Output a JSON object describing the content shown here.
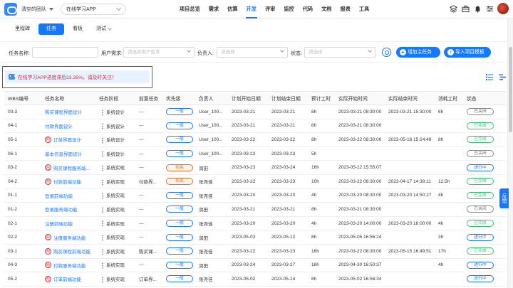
{
  "header": {
    "team_name": "清空的团队",
    "project": "在线学习APP",
    "nav": [
      "项目总览",
      "需求",
      "估算",
      "开发",
      "评审",
      "监控",
      "代码",
      "文档",
      "报表",
      "工具"
    ],
    "active_nav": "开发"
  },
  "subtabs": {
    "items": [
      "里程碑",
      "任务",
      "看板",
      "测试"
    ],
    "active": "任务"
  },
  "filters": {
    "task_name_label": "任务名称:",
    "user_req_label": "用户需求:",
    "user_req_placeholder": "请选择用户需求",
    "owner_label": "负责人:",
    "owner_placeholder": "请选择",
    "status_label": "状态:",
    "status_placeholder": "请选择",
    "add_main_task": "增加主任务",
    "import_template": "导入项目模板"
  },
  "alert": {
    "text": "在线学习APP进度滞后23.35%，请及时关注！"
  },
  "table": {
    "headers": [
      "WBS编号",
      "任务名称",
      "任务阶段",
      "前置任务",
      "优先级",
      "负责人",
      "计划开始日期",
      "计划结束日期",
      "预计工时",
      "实际开始时间",
      "实际结束时间",
      "消耗工时",
      "状态"
    ],
    "rows": [
      {
        "wbs": "03-3",
        "risk": false,
        "name": "购买课程界面设计",
        "stage": "系统设计",
        "pre": "---",
        "prio": "一般",
        "owner": "User_100...",
        "ps": "2023-03-21",
        "pe": "2023-03-21",
        "est": "8h",
        "as": "2023-03-21 08:30:00",
        "ae": "2023-03-21 15:30:00",
        "cost": "6h",
        "status": "已关闭"
      },
      {
        "wbs": "04-1",
        "risk": false,
        "name": "付款界面设计",
        "stage": "系统设计",
        "pre": "---",
        "prio": "一般",
        "owner": "User_100...",
        "ps": "2023-03-21",
        "pe": "2023-03-21",
        "est": "8h",
        "as": "2023-03-21 08:30:00",
        "ae": "",
        "cost": "",
        "status": "已完成"
      },
      {
        "wbs": "05-1",
        "risk": true,
        "name": "订单界面设计",
        "stage": "系统设计",
        "pre": "---",
        "prio": "一般",
        "owner": "User_100...",
        "ps": "2023-03-22",
        "pe": "2023-03-22",
        "est": "8h",
        "as": "2023-03-22 08:30:00",
        "ae": "2023-05-16 15:24:48",
        "cost": "8h",
        "status": "已完成"
      },
      {
        "wbs": "06-1",
        "risk": false,
        "name": "基本信息界面设计",
        "stage": "系统设计",
        "pre": "---",
        "prio": "一般",
        "owner": "User_100...",
        "ps": "2023-03-23",
        "pe": "2023-03-23",
        "est": "5h",
        "as": "",
        "ae": "",
        "cost": "",
        "status": "已关闭"
      },
      {
        "wbs": "03-2",
        "risk": true,
        "name": "购买课程服务端...",
        "stage": "系统实现",
        "pre": "---",
        "prio": "较高",
        "owner": "润田",
        "ps": "2023-03-23",
        "pe": "2023-03-24",
        "est": "16h",
        "as": "2023-05-12 15:55:07",
        "ae": "",
        "cost": "",
        "status": "进行中"
      },
      {
        "wbs": "04-2",
        "risk": true,
        "name": "付款前端功能",
        "stage": "系统实现",
        "pre": "付款界...",
        "prio": "较高",
        "owner": "张尧佳",
        "ps": "2023-03-22",
        "pe": "2023-03-23",
        "est": "10h",
        "as": "2023-03-22 08:30:00",
        "ae": "2023-04-17 14:38:11",
        "cost": "12.5h",
        "status": "已完成"
      },
      {
        "wbs": "01-1",
        "risk": false,
        "name": "登录前端功能",
        "stage": "系统实现",
        "pre": "---",
        "prio": "一般",
        "owner": "张尧佳",
        "ps": "2023-03-20",
        "pe": "2023-03-20",
        "est": "4h",
        "as": "2023-03-20 08:30:00",
        "ae": "2023-03-20 14:50:27",
        "cost": "4h",
        "status": "已完成"
      },
      {
        "wbs": "01-2",
        "risk": false,
        "name": "登录服务端功能",
        "stage": "系统实现",
        "pre": "---",
        "prio": "一般",
        "owner": "润田",
        "ps": "2023-03-21",
        "pe": "2023-03-21",
        "est": "8h",
        "as": "2023-03-21 08:30:00",
        "ae": "",
        "cost": "",
        "status": "已关闭"
      },
      {
        "wbs": "02-1",
        "risk": false,
        "name": "注册前端功能",
        "stage": "系统实现",
        "pre": "---",
        "prio": "一般",
        "owner": "张尧佳",
        "ps": "2023-03-20",
        "pe": "2023-03-20",
        "est": "4h",
        "as": "2023-03-20 14:00:00",
        "ae": "2023-03-20 18:00:00",
        "cost": "4h",
        "status": "已完成"
      },
      {
        "wbs": "02-2",
        "risk": true,
        "name": "注册服务端功能",
        "stage": "系统实现",
        "pre": "---",
        "prio": "一般",
        "owner": "润田",
        "ps": "2023-05-03",
        "pe": "2023-05-12",
        "est": "8h",
        "as": "2023-05-05 16:56:24",
        "ae": "",
        "cost": "3h",
        "status": "进行中"
      },
      {
        "wbs": "03-1",
        "risk": true,
        "name": "购买课程前端功能",
        "stage": "系统实现",
        "pre": "购买课...",
        "prio": "一般",
        "owner": "张尧佳",
        "ps": "2023-03-22",
        "pe": "2023-03-23",
        "est": "16h",
        "as": "2023-03-22 08:30:00",
        "ae": "2023-05-15 16:49:51",
        "cost": "17h",
        "status": "已完成"
      },
      {
        "wbs": "04-3",
        "risk": true,
        "name": "付款服务端功能",
        "stage": "系统实现",
        "pre": "---",
        "prio": "一般",
        "owner": "润田",
        "ps": "2023-03-24",
        "pe": "2023-03-27",
        "est": "16h",
        "as": "2023-04-30 16:50:37",
        "ae": "",
        "cost": "4h",
        "status": "进行中"
      },
      {
        "wbs": "05-2",
        "risk": true,
        "name": "订单前端功能",
        "stage": "系统实现",
        "pre": "订单界...",
        "prio": "一般",
        "owner": "张尧佳",
        "ps": "2023-05-02",
        "pe": "2023-05-14",
        "est": "8h",
        "as": "2023-05-02 16:56:34",
        "ae": "",
        "cost": "",
        "status": "进行中"
      }
    ]
  },
  "side": {
    "feedback": "反馈"
  },
  "colors": {
    "accent": "#1677ff",
    "alert_text": "#e0262c",
    "alert_border": "#e0262c",
    "high_priority": "#e8702a",
    "done": "#2ec46d"
  }
}
